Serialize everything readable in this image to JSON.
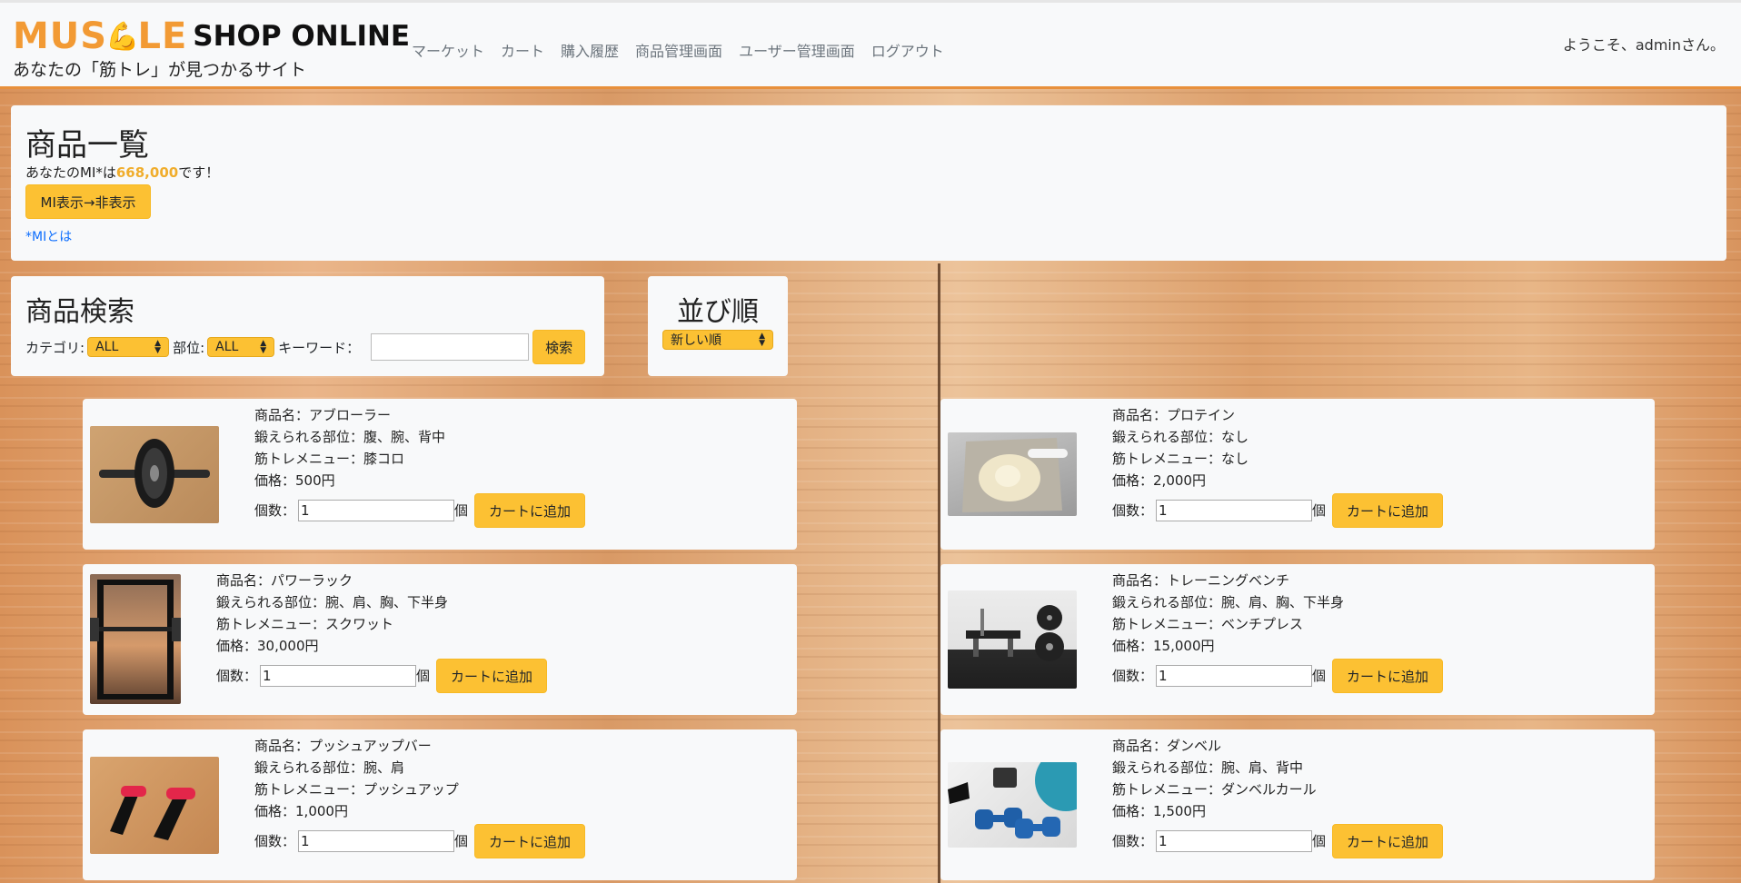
{
  "brand": {
    "muscle_left": "MUS",
    "muscle_right": "LE",
    "shop": "SHOP ONLINE",
    "tagline": "あなたの「筋トレ」が見つかるサイト"
  },
  "nav": [
    "マーケット",
    "カート",
    "購入履歴",
    "商品管理画面",
    "ユーザー管理画面",
    "ログアウト"
  ],
  "welcome": "ようこそ、adminさん。",
  "list_section": {
    "title": "商品一覧",
    "mi_prefix": "あなたのMI*は",
    "mi_value": "668,000",
    "mi_suffix": "です！",
    "toggle_button": "MI表示→非表示",
    "mi_link": "*MIとは"
  },
  "search": {
    "title": "商品検索",
    "category_label": "カテゴリ:",
    "category_value": "ALL",
    "part_label": "部位:",
    "part_value": "ALL",
    "keyword_label": "キーワード：",
    "keyword_value": "",
    "button": "検索"
  },
  "sort": {
    "title": "並び順",
    "value": "新しい順"
  },
  "labels": {
    "name": "商品名：",
    "part": "鍛えられる部位：",
    "menu": "筋トレメニュー：",
    "price": "価格：",
    "qty": "個数：",
    "unit": "個",
    "add_to_cart": "カートに追加"
  },
  "products": [
    {
      "name": "アブローラー",
      "part": "腹、腕、背中",
      "menu": "膝コロ",
      "price": "500円",
      "qty": "1",
      "image": "ab-roller-image"
    },
    {
      "name": "プロテイン",
      "part": "なし",
      "menu": "なし",
      "price": "2,000円",
      "qty": "1",
      "image": "protein-image"
    },
    {
      "name": "パワーラック",
      "part": "腕、肩、胸、下半身",
      "menu": "スクワット",
      "price": "30,000円",
      "qty": "1",
      "image": "power-rack-image"
    },
    {
      "name": "トレーニングベンチ",
      "part": "腕、肩、胸、下半身",
      "menu": "ベンチプレス",
      "price": "15,000円",
      "qty": "1",
      "image": "bench-image"
    },
    {
      "name": "プッシュアップバー",
      "part": "腕、肩",
      "menu": "プッシュアップ",
      "price": "1,000円",
      "qty": "1",
      "image": "pushup-bar-image"
    },
    {
      "name": "ダンベル",
      "part": "腕、肩、背中",
      "menu": "ダンベルカール",
      "price": "1,500円",
      "qty": "1",
      "image": "dumbbell-image"
    }
  ],
  "colors": {
    "accent": "#fcc133",
    "brand_orange": "#f29a34",
    "link": "#0d6efd",
    "panel": "#f8f9fa"
  }
}
